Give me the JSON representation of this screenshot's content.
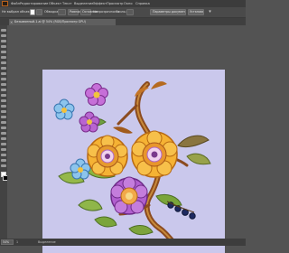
{
  "app": {
    "logo_text": "Ai"
  },
  "menubar": {
    "items": [
      "Файл",
      "Редактирование",
      "Объект",
      "Текст",
      "Выделение",
      "Эффект",
      "Просмотр",
      "Окно",
      "Справка"
    ]
  },
  "options_bar": {
    "selection_label": "Не выбран объект",
    "stroke_label": "Обводка:",
    "uniform_label": "Равномерно",
    "basic_label": "Основная",
    "opacity_label": "Непрозрачность",
    "style_label": "Стиль:",
    "document_setup_button": "Параметры документа",
    "preferences_button": "Установки"
  },
  "document": {
    "tab_title": "Безымянный-1.ai @ 54% (RGB/Просмотр GPU)"
  },
  "status_bar": {
    "zoom_value": "54%",
    "artboard_number": "1",
    "tool_name": "Выделение"
  },
  "colors": {
    "artboard_background": "#cac8ec",
    "fill_swatch": "#ffffff",
    "stroke_swatch": "#000000"
  },
  "icons": [
    "close-icon",
    "arrow-icon",
    "brush-icon",
    "grid-icon"
  ]
}
